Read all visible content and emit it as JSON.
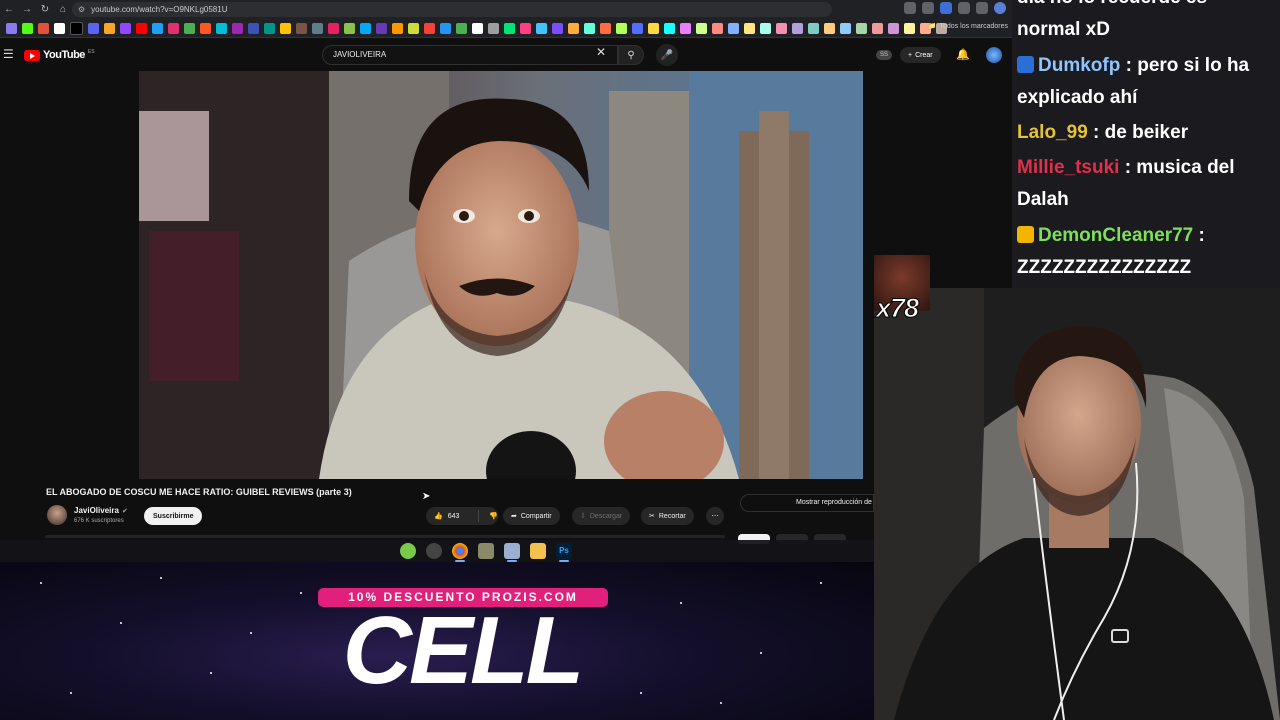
{
  "browser": {
    "url": "youtube.com/watch?v=O9NKLg0581U",
    "bookmarks_folder": "Todos los marcadores"
  },
  "youtube": {
    "logo": "YouTube",
    "logo_superscript": "ES",
    "search_value": "JAVIOLIVEIRA",
    "create_label": "Crear",
    "ss_badge": "SS"
  },
  "video": {
    "title": "EL ABOGADO DE COSCU ME HACE RATIO: GUIBEL REVIEWS (parte 3)",
    "channel": "JaviOliveira",
    "subscribers": "676 K suscriptores",
    "subscribe_label": "Suscribirme",
    "likes": "643",
    "share_label": "Compartir",
    "download_label": "Descargar",
    "clip_label": "Recortar",
    "replay_label": "Mostrar reproducción de chat"
  },
  "sponsor": {
    "discount": "10% DESCUENTO PROZIS.COM",
    "product": "CELL"
  },
  "chat": {
    "lines": [
      {
        "name": "",
        "text": "dia no lo recuerde es normal xD",
        "name_color": "#ffffff"
      },
      {
        "name": "Dumkofp",
        "text": " : pero si lo ha explicado ahí",
        "name_color": "#8ec5ff"
      },
      {
        "name": "Lalo_99",
        "text": " : de beiker",
        "name_color": "#e6c23a"
      },
      {
        "name": "Millie_tsuki",
        "text": " : musica del Dalah",
        "name_color": "#e0304a"
      },
      {
        "name": "DemonCleaner77",
        "text": " : ZZZZZZZZZZZZZZZ",
        "name_color": "#7ee05a"
      }
    ]
  },
  "emote": {
    "count": "x78"
  },
  "colors": {
    "youtube_red": "#ff0000",
    "discount_pink": "#e0207a",
    "chat_bg": "#1a1a1f"
  }
}
